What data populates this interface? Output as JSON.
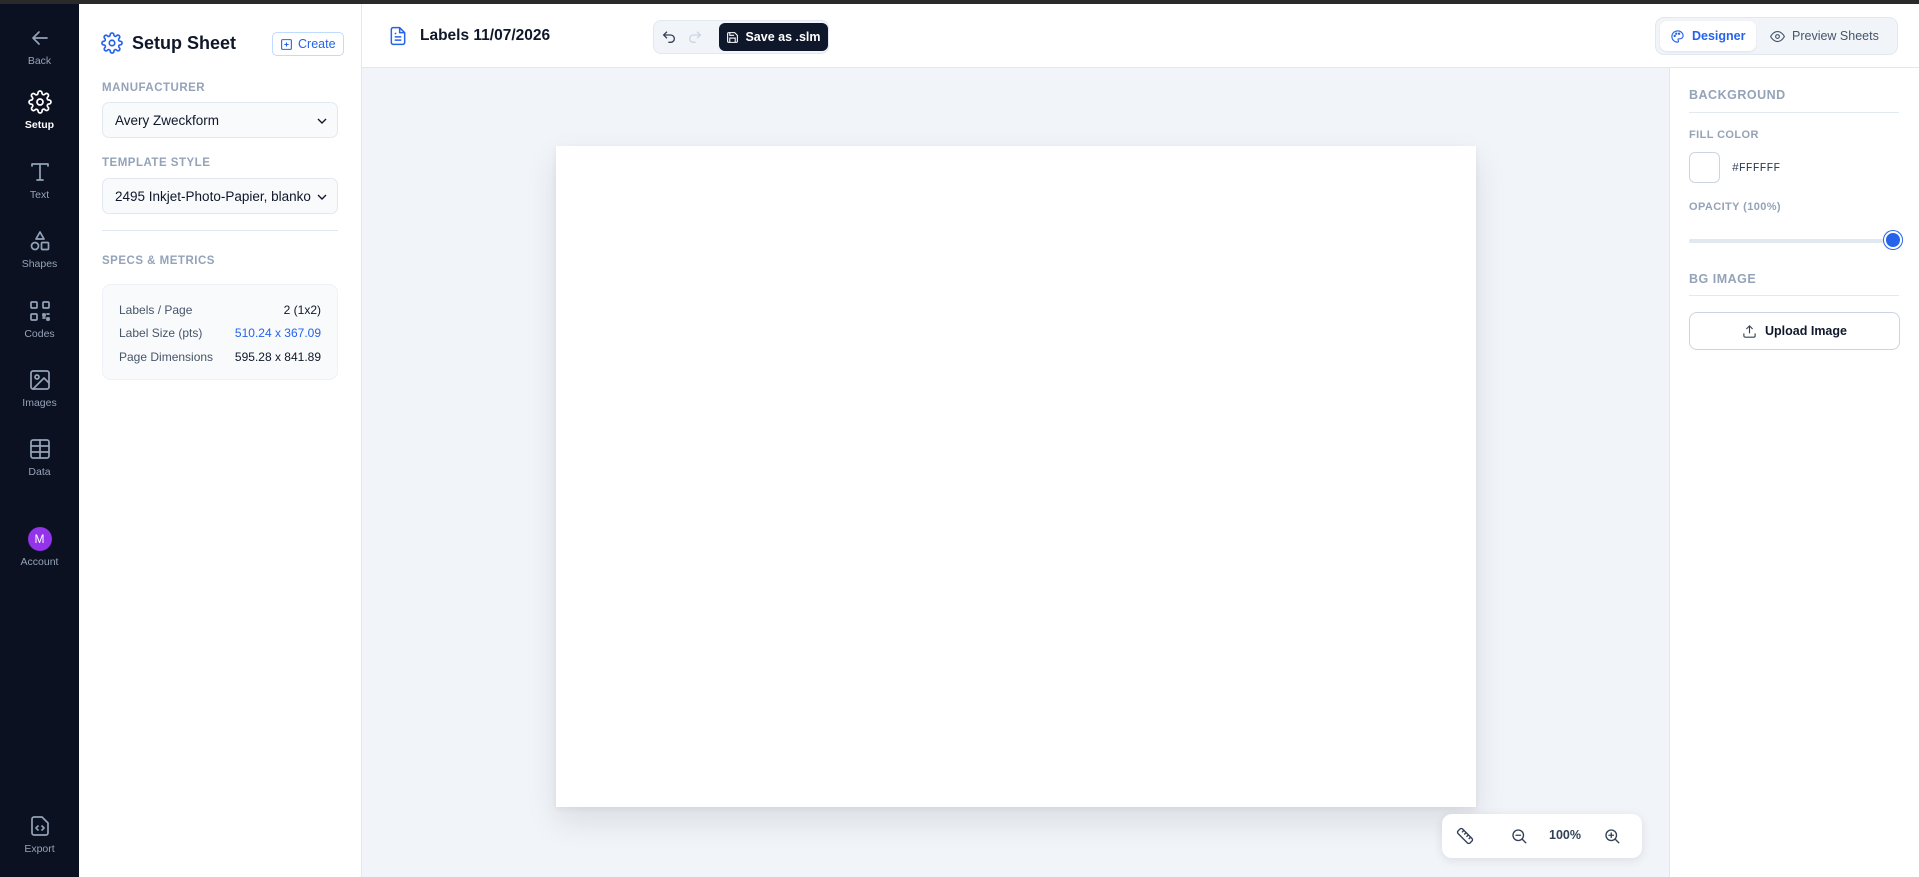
{
  "nav": {
    "items": [
      {
        "label": "Back",
        "icon": "arrow-left-icon"
      },
      {
        "label": "Setup",
        "icon": "gear-icon",
        "active": true
      },
      {
        "label": "Text",
        "icon": "text-icon"
      },
      {
        "label": "Shapes",
        "icon": "shapes-icon"
      },
      {
        "label": "Codes",
        "icon": "qr-code-icon"
      },
      {
        "label": "Images",
        "icon": "image-icon"
      },
      {
        "label": "Data",
        "icon": "table-icon"
      },
      {
        "label": "Account",
        "icon": "avatar",
        "avatar_letter": "M"
      },
      {
        "label": "Export",
        "icon": "code-file-icon"
      }
    ]
  },
  "setup": {
    "title": "Setup Sheet",
    "create_label": "Create",
    "manufacturer_label": "MANUFACTURER",
    "manufacturer_value": "Avery Zweckform",
    "template_label": "TEMPLATE STYLE",
    "template_value": "2495 Inkjet-Photo-Papier, blanko",
    "specs_label": "SPECS & METRICS",
    "specs": [
      {
        "key": "Labels / Page",
        "value": "2 (1x2)"
      },
      {
        "key": "Label Size (pts)",
        "value": "510.24 x 367.09"
      },
      {
        "key": "Page Dimensions",
        "value": "595.28 x 841.89"
      }
    ]
  },
  "topbar": {
    "doc_title": "Labels 11/07/2026",
    "save_label": "Save as .slm",
    "designer_label": "Designer",
    "preview_label": "Preview Sheets"
  },
  "canvas": {
    "zoom": "100%"
  },
  "properties": {
    "background_label": "BACKGROUND",
    "fill_color_label": "FILL COLOR",
    "fill_color": "#FFFFFF",
    "opacity_label": "OPACITY (100%)",
    "opacity": 1.0,
    "bg_image_label": "BG IMAGE",
    "upload_label": "Upload Image"
  },
  "colors": {
    "accent": "#2563eb",
    "rail_bg": "#0b1120",
    "avatar": "#9333ea"
  }
}
